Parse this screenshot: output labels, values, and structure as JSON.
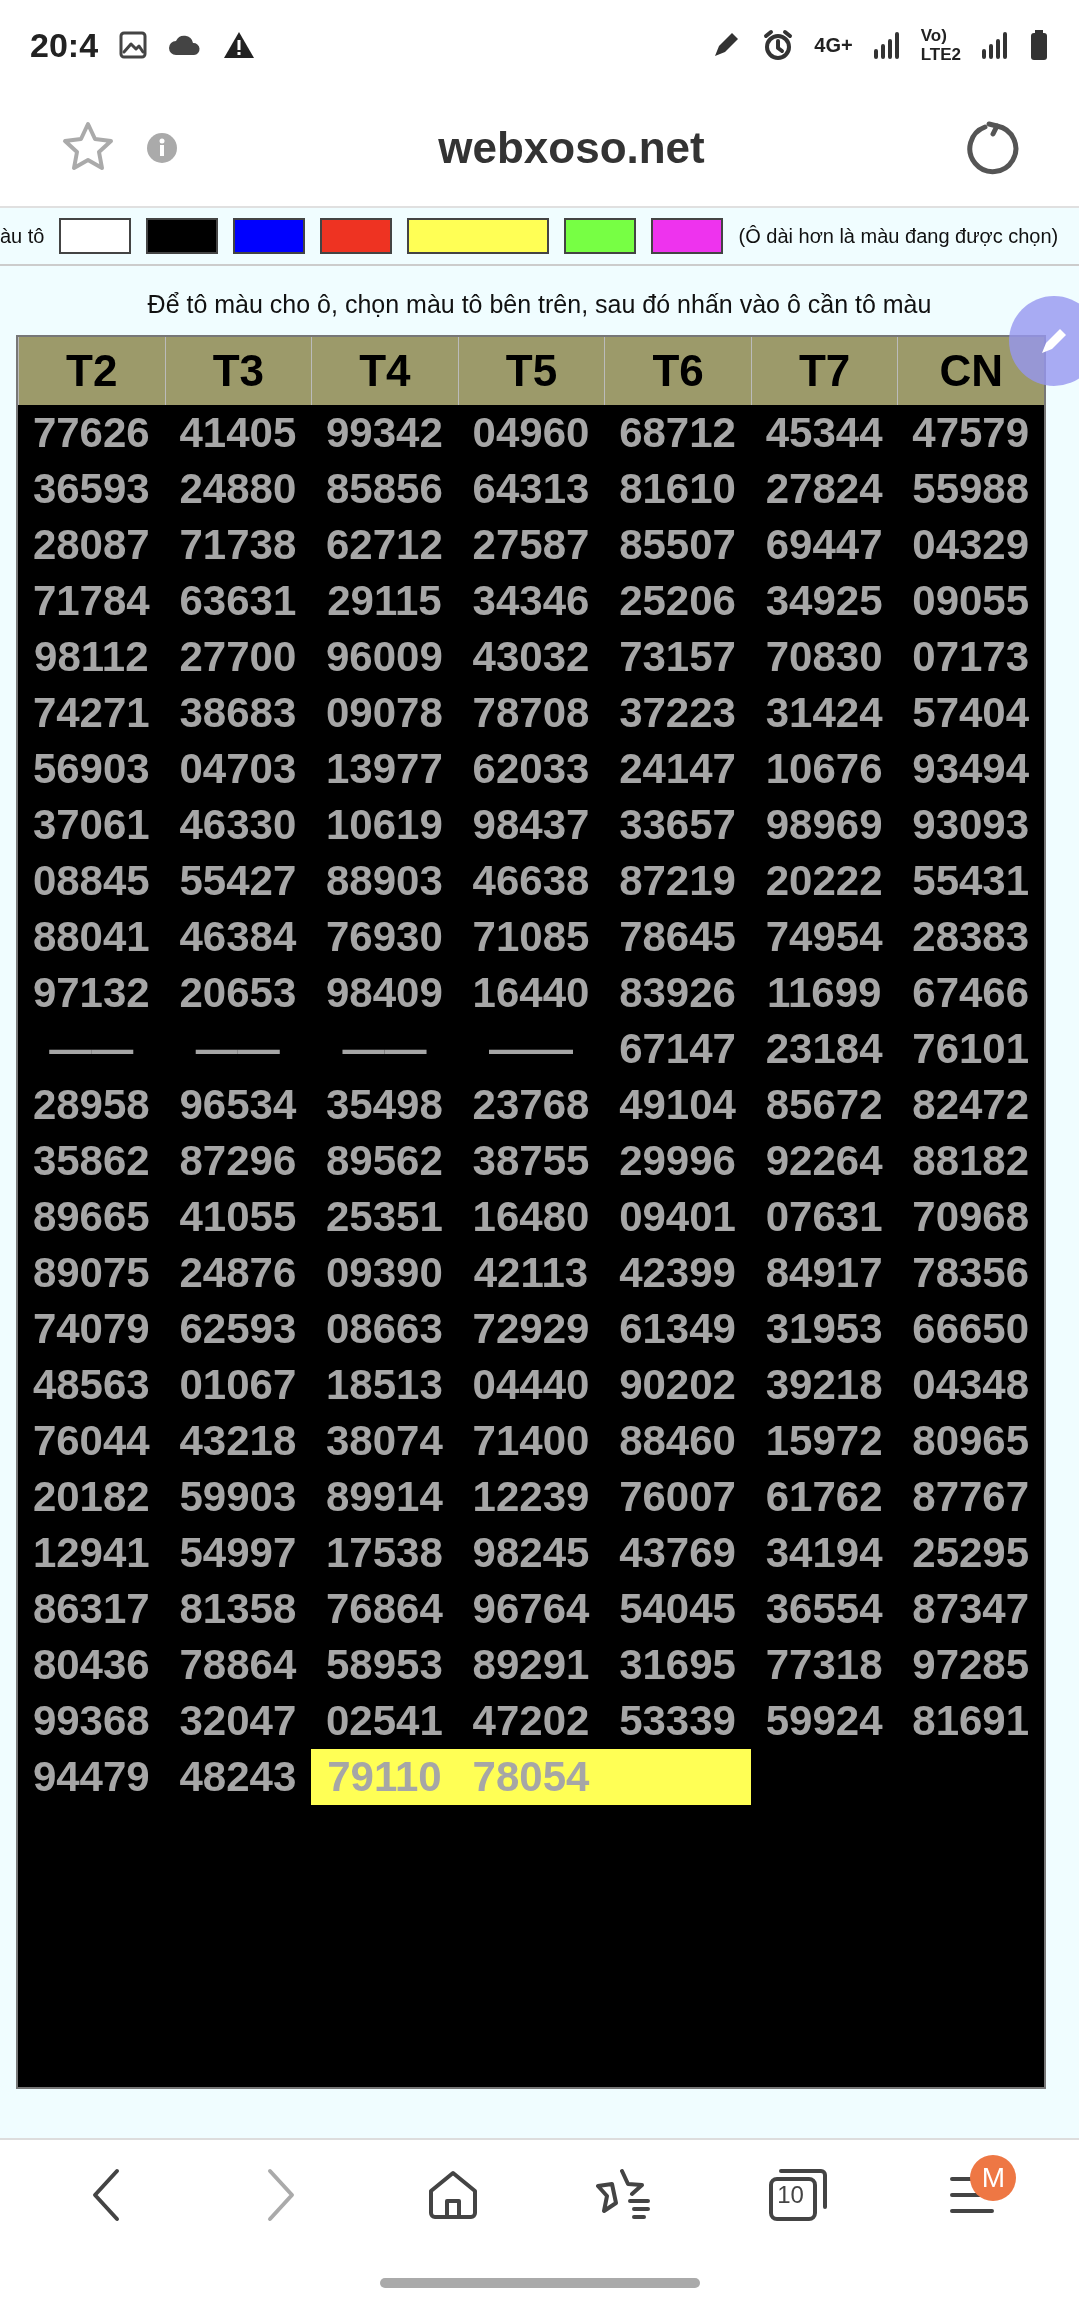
{
  "status_bar": {
    "time": "20:4",
    "network": "4G+",
    "volte": "Vo)",
    "lte": "LTE2"
  },
  "address_bar": {
    "title": "webxoso.net"
  },
  "palette": {
    "label": "àu tô",
    "note": "(Ô dài hơn là màu đang được chọn)",
    "swatches": [
      {
        "color": "#ffffff",
        "selected": false
      },
      {
        "color": "#000000",
        "selected": false
      },
      {
        "color": "#0000ff",
        "selected": false
      },
      {
        "color": "#ee3322",
        "selected": false
      },
      {
        "color": "#ffff55",
        "selected": true
      },
      {
        "color": "#77ff44",
        "selected": false
      },
      {
        "color": "#ee33ee",
        "selected": false
      }
    ]
  },
  "instruction": "Để tô màu cho ô, chọn màu tô bên trên, sau đó nhấn vào ô cần tô màu",
  "table": {
    "columns": [
      "T2",
      "T3",
      "T4",
      "T5",
      "T6",
      "T7",
      "CN"
    ],
    "rows": [
      [
        "77626",
        "41405",
        "99342",
        "04960",
        "68712",
        "45344",
        "47579"
      ],
      [
        "36593",
        "24880",
        "85856",
        "64313",
        "81610",
        "27824",
        "55988"
      ],
      [
        "28087",
        "71738",
        "62712",
        "27587",
        "85507",
        "69447",
        "04329"
      ],
      [
        "71784",
        "63631",
        "29115",
        "34346",
        "25206",
        "34925",
        "09055"
      ],
      [
        "98112",
        "27700",
        "96009",
        "43032",
        "73157",
        "70830",
        "07173"
      ],
      [
        "74271",
        "38683",
        "09078",
        "78708",
        "37223",
        "31424",
        "57404"
      ],
      [
        "56903",
        "04703",
        "13977",
        "62033",
        "24147",
        "10676",
        "93494"
      ],
      [
        "37061",
        "46330",
        "10619",
        "98437",
        "33657",
        "98969",
        "93093"
      ],
      [
        "08845",
        "55427",
        "88903",
        "46638",
        "87219",
        "20222",
        "55431"
      ],
      [
        "88041",
        "46384",
        "76930",
        "71085",
        "78645",
        "74954",
        "28383"
      ],
      [
        "97132",
        "20653",
        "98409",
        "16440",
        "83926",
        "11699",
        "67466"
      ],
      [
        "——",
        "——",
        "——",
        "——",
        "67147",
        "23184",
        "76101"
      ],
      [
        "28958",
        "96534",
        "35498",
        "23768",
        "49104",
        "85672",
        "82472"
      ],
      [
        "35862",
        "87296",
        "89562",
        "38755",
        "29996",
        "92264",
        "88182"
      ],
      [
        "89665",
        "41055",
        "25351",
        "16480",
        "09401",
        "07631",
        "70968"
      ],
      [
        "89075",
        "24876",
        "09390",
        "42113",
        "42399",
        "84917",
        "78356"
      ],
      [
        "74079",
        "62593",
        "08663",
        "72929",
        "61349",
        "31953",
        "66650"
      ],
      [
        "48563",
        "01067",
        "18513",
        "04440",
        "90202",
        "39218",
        "04348"
      ],
      [
        "76044",
        "43218",
        "38074",
        "71400",
        "88460",
        "15972",
        "80965"
      ],
      [
        "20182",
        "59903",
        "89914",
        "12239",
        "76007",
        "61762",
        "87767"
      ],
      [
        "12941",
        "54997",
        "17538",
        "98245",
        "43769",
        "34194",
        "25295"
      ],
      [
        "86317",
        "81358",
        "76864",
        "96764",
        "54045",
        "36554",
        "87347"
      ],
      [
        "80436",
        "78864",
        "58953",
        "89291",
        "31695",
        "77318",
        "97285"
      ],
      [
        "99368",
        "32047",
        "02541",
        "47202",
        "53339",
        "59924",
        "81691"
      ],
      [
        "94479",
        "48243",
        {
          "text": "79110",
          "color": "#ffff55"
        },
        {
          "text": "78054",
          "color": "#ffff55"
        },
        {
          "color": "#ffff55"
        }
      ]
    ]
  },
  "bottom_nav": {
    "forward_disabled": true,
    "tabs_count": "10",
    "badge": "M"
  }
}
